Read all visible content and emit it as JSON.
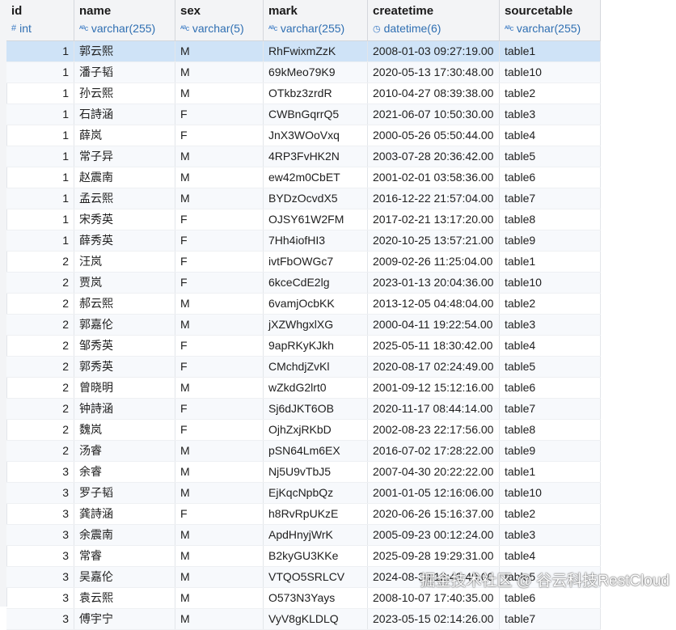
{
  "columns": [
    {
      "name": "id",
      "type": "int",
      "icon": "hash-icon",
      "numeric": true
    },
    {
      "name": "name",
      "type": "varchar(255)",
      "icon": "abc-icon"
    },
    {
      "name": "sex",
      "type": "varchar(5)",
      "icon": "abc-icon"
    },
    {
      "name": "mark",
      "type": "varchar(255)",
      "icon": "abc-icon"
    },
    {
      "name": "createtime",
      "type": "datetime(6)",
      "icon": "clock-icon"
    },
    {
      "name": "sourcetable",
      "type": "varchar(255)",
      "icon": "abc-icon"
    }
  ],
  "selected_row": 0,
  "rows": [
    [
      "1",
      "郭云熙",
      "M",
      "RhFwixmZzK",
      "2008-01-03 09:27:19.00",
      "table1"
    ],
    [
      "1",
      "潘子韬",
      "M",
      "69kMeo79K9",
      "2020-05-13 17:30:48.00",
      "table10"
    ],
    [
      "1",
      "孙云熙",
      "M",
      "OTkbz3zrdR",
      "2010-04-27 08:39:38.00",
      "table2"
    ],
    [
      "1",
      "石詩涵",
      "F",
      "CWBnGqrrQ5",
      "2021-06-07 10:50:30.00",
      "table3"
    ],
    [
      "1",
      "薛岚",
      "F",
      "JnX3WOoVxq",
      "2000-05-26 05:50:44.00",
      "table4"
    ],
    [
      "1",
      "常子异",
      "M",
      "4RP3FvHK2N",
      "2003-07-28 20:36:42.00",
      "table5"
    ],
    [
      "1",
      "赵震南",
      "M",
      "ew42m0CbET",
      "2001-02-01 03:58:36.00",
      "table6"
    ],
    [
      "1",
      "孟云熙",
      "M",
      "BYDzOcvdX5",
      "2016-12-22 21:57:04.00",
      "table7"
    ],
    [
      "1",
      "宋秀英",
      "F",
      "OJSY61W2FM",
      "2017-02-21 13:17:20.00",
      "table8"
    ],
    [
      "1",
      "薛秀英",
      "F",
      "7Hh4iofHI3",
      "2020-10-25 13:57:21.00",
      "table9"
    ],
    [
      "2",
      "汪岚",
      "F",
      "ivtFbOWGc7",
      "2009-02-26 11:25:04.00",
      "table1"
    ],
    [
      "2",
      "贾岚",
      "F",
      "6kceCdE2lg",
      "2023-01-13 20:04:36.00",
      "table10"
    ],
    [
      "2",
      "郝云熙",
      "M",
      "6vamjOcbKK",
      "2013-12-05 04:48:04.00",
      "table2"
    ],
    [
      "2",
      "郭嘉伦",
      "M",
      "jXZWhgxlXG",
      "2000-04-11 19:22:54.00",
      "table3"
    ],
    [
      "2",
      "邹秀英",
      "F",
      "9apRKyKJkh",
      "2025-05-11 18:30:42.00",
      "table4"
    ],
    [
      "2",
      "郭秀英",
      "F",
      "CMchdjZvKl",
      "2020-08-17 02:24:49.00",
      "table5"
    ],
    [
      "2",
      "曾晓明",
      "M",
      "wZkdG2lrt0",
      "2001-09-12 15:12:16.00",
      "table6"
    ],
    [
      "2",
      "钟詩涵",
      "F",
      "Sj6dJKT6OB",
      "2020-11-17 08:44:14.00",
      "table7"
    ],
    [
      "2",
      "魏岚",
      "F",
      "OjhZxjRKbD",
      "2002-08-23 22:17:56.00",
      "table8"
    ],
    [
      "2",
      "汤睿",
      "M",
      "pSN64Lm6EX",
      "2016-07-02 17:28:22.00",
      "table9"
    ],
    [
      "3",
      "余睿",
      "M",
      "Nj5U9vTbJ5",
      "2007-04-30 20:22:22.00",
      "table1"
    ],
    [
      "3",
      "罗子韬",
      "M",
      "EjKqcNpbQz",
      "2001-01-05 12:16:06.00",
      "table10"
    ],
    [
      "3",
      "龚詩涵",
      "F",
      "h8RvRpUKzE",
      "2020-06-26 15:16:37.00",
      "table2"
    ],
    [
      "3",
      "余震南",
      "M",
      "ApdHnyjWrK",
      "2005-09-23 00:12:24.00",
      "table3"
    ],
    [
      "3",
      "常睿",
      "M",
      "B2kyGU3KKe",
      "2025-09-28 19:29:31.00",
      "table4"
    ],
    [
      "3",
      "吴嘉伦",
      "M",
      "VTQO5SRLCV",
      "2024-08-30 12:43:49.00",
      "table5"
    ],
    [
      "3",
      "袁云熙",
      "M",
      "O573N3Yays",
      "2008-10-07 17:40:35.00",
      "table6"
    ],
    [
      "3",
      "傅宇宁",
      "M",
      "VyV8gKLDLQ",
      "2023-05-15 02:14:26.00",
      "table7"
    ]
  ],
  "watermark": "掘金技术社区 @ 谷云科技RestCloud"
}
